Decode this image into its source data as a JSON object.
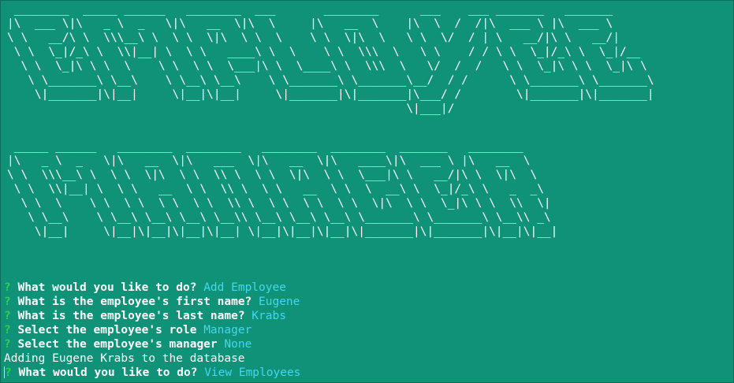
{
  "banner": {
    "employee": " ________  _____ ______   ________  ___       ________      ___    ___ _______   _______\n|\\  ___ \\|\\   _ \\  _   \\|\\   __  \\|\\  \\     |\\   __  \\    |\\  \\  /  /|\\  ___ \\ |\\  ___ \\\n\\ \\   __/\\ \\  \\\\\\__\\ \\  \\ \\  \\|\\  \\ \\  \\    \\ \\  \\|\\  \\   \\ \\  \\/  / | \\   __/|\\ \\   __/|\n \\ \\  \\_|/_\\ \\  \\\\|__| \\  \\ \\   ____\\ \\  \\    \\ \\  \\\\\\  \\   \\ \\    / / \\ \\  \\_|/_\\ \\  \\_|/__\n  \\ \\  \\_|\\ \\ \\  \\    \\ \\  \\ \\  \\___|\\ \\  \\____\\ \\  \\\\\\  \\   \\/  /  /   \\ \\  \\_|\\ \\ \\  \\_|\\ \\\n   \\ \\_______\\ \\__\\    \\ \\__\\ \\__\\    \\ \\_______\\ \\_______\\__/  / /      \\ \\_______\\ \\_______\\\n    \\|_______|\\|__|     \\|__|\\|__|     \\|_______|\\|_______|\\___/ /        \\|_______|\\|_______|\n                                                          \\|___|/",
    "manager": " _____ ______   ________  ________   ________  ________  _______   ________\n|\\   _ \\  _   \\|\\   __  \\|\\   ___  \\|\\   __  \\|\\   ____\\|\\  ___ \\ |\\   __  \\\n\\ \\  \\\\\\__\\ \\  \\ \\  \\|\\  \\ \\  \\\\ \\  \\ \\  \\|\\  \\ \\  \\___|\\ \\   __/|\\ \\  \\|\\  \\\n \\ \\  \\\\|__| \\  \\ \\   __  \\ \\  \\\\ \\  \\ \\   __  \\ \\  \\  __\\ \\  \\_|/_\\ \\   _  _\\\n  \\ \\  \\    \\ \\  \\ \\  \\ \\  \\ \\  \\\\ \\  \\ \\  \\ \\  \\ \\  \\|\\  \\ \\  \\_|\\ \\ \\  \\\\  \\|\n   \\ \\__\\    \\ \\__\\ \\__\\ \\__\\ \\__\\\\ \\__\\ \\__\\ \\__\\ \\_______\\ \\_______\\ \\__\\\\ _\\\n    \\|__|     \\|__|\\|__|\\|__|\\|__| \\|__|\\|__|\\|__|\\|_______|\\|_______|\\|__|\\|__|"
  },
  "session": [
    {
      "type": "prompt",
      "mark": "?",
      "question": "What would you like to do?",
      "answer": "Add Employee"
    },
    {
      "type": "prompt",
      "mark": "?",
      "question": "What is the employee's first name?",
      "answer": "Eugene"
    },
    {
      "type": "prompt",
      "mark": "?",
      "question": "What is the employee's last name?",
      "answer": "Krabs"
    },
    {
      "type": "prompt",
      "mark": "?",
      "question": "Select the employee's role",
      "answer": "Manager"
    },
    {
      "type": "prompt",
      "mark": "?",
      "question": "Select the employee's manager",
      "answer": "None"
    },
    {
      "type": "output",
      "text": "Adding Eugene Krabs to the database"
    },
    {
      "type": "prompt",
      "mark": "?",
      "question": "What would you like to do?",
      "answer": "View Employees"
    }
  ],
  "colors": {
    "background": "#0f9278",
    "question_mark": "#2fd14f",
    "answer": "#45d7ee",
    "text": "#ffffff"
  }
}
